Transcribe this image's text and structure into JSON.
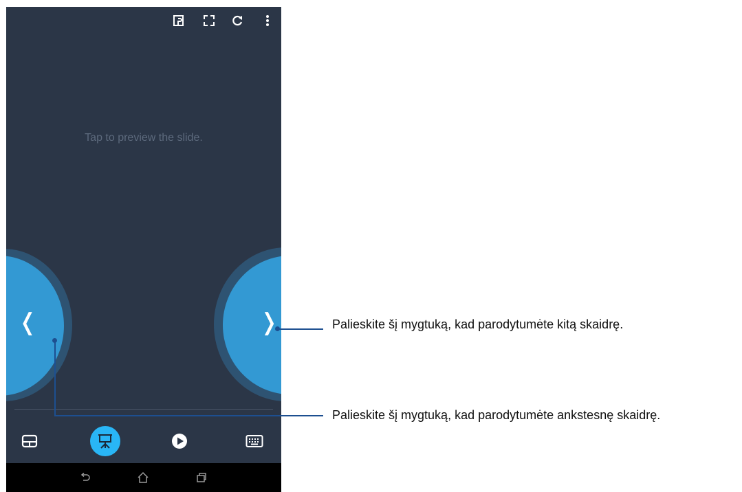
{
  "screen": {
    "hint_text": "Tap to preview the slide.",
    "prev_symbol": "❬",
    "next_symbol": "❭"
  },
  "top_icons": [
    "pointer-mode-icon",
    "fullscreen-icon",
    "refresh-icon",
    "more-vert-icon"
  ],
  "bottom_icons": [
    "touchpad-icon",
    "presentation-icon",
    "play-icon",
    "keyboard-icon"
  ],
  "nav_icons": [
    "back-icon",
    "home-icon",
    "recents-icon"
  ],
  "callouts": {
    "next": "Palieskite šį mygtuką, kad parodytumėte kitą skaidrę.",
    "previous": "Palieskite šį mygtuką, kad parodytumėte ankstesnę skaidrę."
  },
  "colors": {
    "screen_bg": "#2b3647",
    "accent": "#3399d3",
    "active_button": "#29b6f6",
    "callout_line": "#1d4f90"
  }
}
